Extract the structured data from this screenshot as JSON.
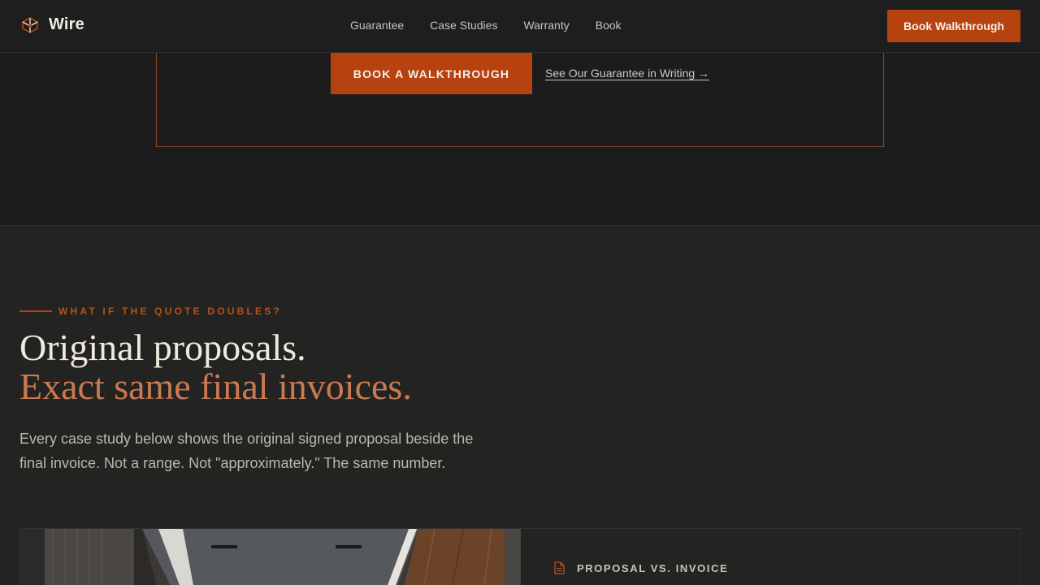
{
  "nav": {
    "brand": "Wire",
    "links": [
      "Guarantee",
      "Case Studies",
      "Warranty",
      "Book"
    ],
    "cta": "Book Walkthrough"
  },
  "hero": {
    "cta": "BOOK A WALKTHROUGH",
    "link": "See Our Guarantee in Writing →"
  },
  "section": {
    "eyebrow": "WHAT IF THE QUOTE DOUBLES?",
    "headline_line1": "Original proposals.",
    "headline_line2": "Exact same final invoices.",
    "lead": "Every case study below shows the original signed proposal beside the final invoice. Not a range. Not \"approximately.\" The same number.",
    "card_label": "PROPOSAL VS. INVOICE"
  },
  "colors": {
    "accent": "#b5420f",
    "accent_text": "#c97a52",
    "background": "#1d1d1d",
    "section_background": "#232321"
  },
  "icons": {
    "brand": "wire-logo-icon",
    "card_label": "document-icon"
  }
}
